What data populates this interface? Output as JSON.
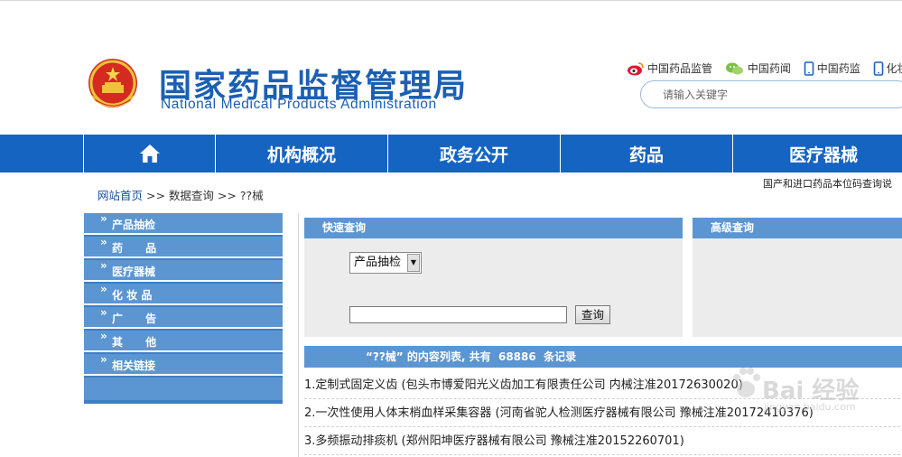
{
  "header": {
    "title_cn": "国家药品监督管理局",
    "title_en": "National Medical Products Administration",
    "social_links": [
      {
        "label": "中国药品监管",
        "icon": "weibo-icon"
      },
      {
        "label": "中国药闻",
        "icon": "wechat-icon"
      },
      {
        "label": "中国药监",
        "icon": "mobile-icon"
      },
      {
        "label": "化妆品",
        "icon": "mobile-icon"
      }
    ],
    "search_placeholder": "请输入关键字"
  },
  "nav": {
    "home_icon": "home-icon",
    "items": [
      "机构概况",
      "政务公开",
      "药品",
      "医疗器械"
    ]
  },
  "breadcrumb": {
    "home": "网站首页",
    "sep1": " >> ",
    "section": "数据查询",
    "sep2": " >> ",
    "current": "??械"
  },
  "marquee_text": "国产和进口药品本位码查询说",
  "sidebar": {
    "items": [
      {
        "label": "产品抽检"
      },
      {
        "label": "药      品"
      },
      {
        "label": "医疗器械"
      },
      {
        "label": "化 妆 品"
      },
      {
        "label": "广      告"
      },
      {
        "label": "其      他"
      },
      {
        "label": "相关链接"
      }
    ]
  },
  "quick_search": {
    "title": "快速查询",
    "select_value": "产品抽检",
    "input_value": "",
    "button_label": "查询"
  },
  "advanced_search": {
    "title": "高级查询"
  },
  "results": {
    "header": "“??械” 的内容列表, 共有  68886  条记录",
    "rows": [
      "1.定制式固定义齿 (包头市博爱阳光义齿加工有限责任公司 内械注准20172630020)",
      "2.一次性使用人体末梢血样采集容器 (河南省驼人检测医疗器械有限公司 豫械注准20172410376)",
      "3.多频振动排痰机 (郑州阳坤医疗器械有限公司 豫械注准20152260701)"
    ]
  },
  "watermark": {
    "text": "Bai 经验",
    "sub": "jingyan.baidu.com"
  },
  "colors": {
    "brand_blue": "#1664c2",
    "logo_blue": "#1b5fb3",
    "panel_blue": "#5b96d2",
    "sidebar_blue": "#3f7ec4"
  }
}
